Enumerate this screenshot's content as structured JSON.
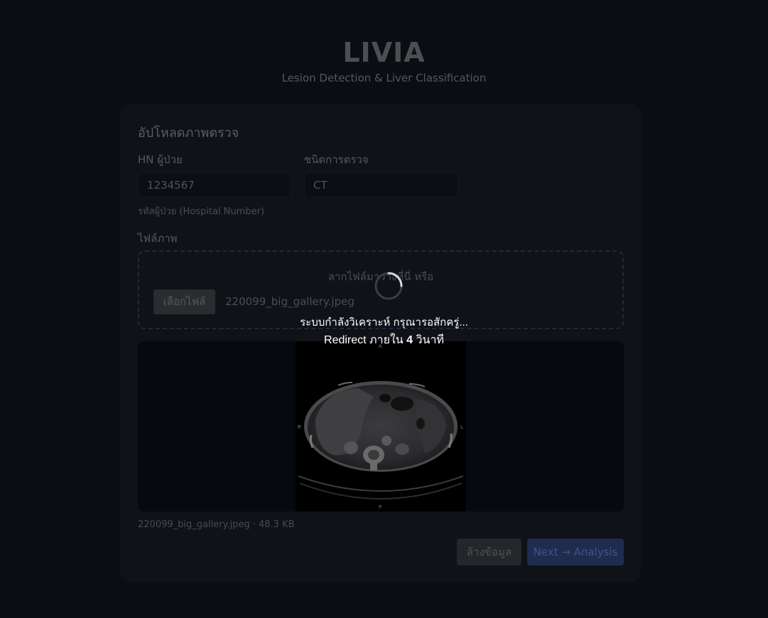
{
  "app": {
    "title": "LIVIA",
    "subtitle": "Lesion Detection & Liver Classification"
  },
  "form": {
    "title": "อัปโหลดภาพตรวจ",
    "hn_label": "HN ผู้ป่วย",
    "hn_value": "1234567",
    "hn_hint": "รหัสผู้ป่วย (Hospital Number)",
    "modality_label": "ชนิดการตรวจ",
    "modality_value": "CT",
    "file_label": "ไฟล์ภาพ",
    "drop_text": "ลากไฟล์มาวางที่นี่ หรือ",
    "choose_file_label": "เลือกไฟล์",
    "chosen_file": "220099_big_gallery.jpeg",
    "file_meta": "220099_big_gallery.jpeg · 48.3 KB",
    "clear_label": "ล้างข้อมูล",
    "next_label": "Next → Analysis"
  },
  "preview": {
    "markers": {
      "right": "R",
      "left": "L",
      "posterior": "P",
      "anterior": "A"
    }
  },
  "overlay": {
    "status_text": "ระบบกำลังวิเคราะห์ กรุณารอสักครู่...",
    "redirect_prefix": "Redirect ภายใน",
    "redirect_seconds": "4",
    "redirect_suffix": "วินาที"
  },
  "colors": {
    "background": "#0b0d12",
    "card": "#0f1217",
    "primary_button": "#1f2c4e",
    "dropzone_border": "#1c2a3c"
  }
}
